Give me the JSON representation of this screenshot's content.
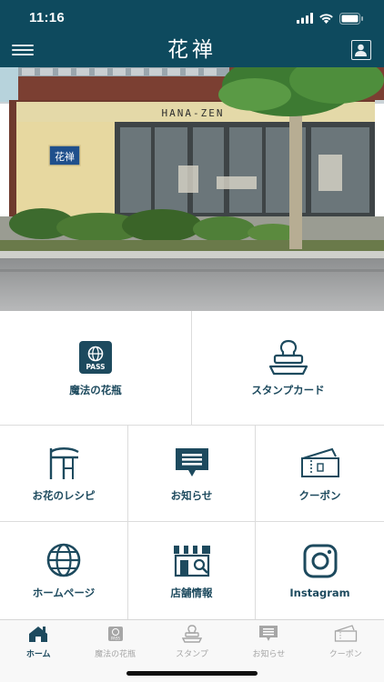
{
  "status": {
    "time": "11:16"
  },
  "header": {
    "title": "花禅"
  },
  "hero": {
    "sign_text": "HANA-ZEN",
    "plaque_text": "花禅"
  },
  "tiles": [
    {
      "label": "魔法の花瓶",
      "icon": "pass-icon",
      "badge": "PASS"
    },
    {
      "label": "スタンプカード",
      "icon": "stamp-icon"
    },
    {
      "label": "お花のレシピ",
      "icon": "recipe-icon"
    },
    {
      "label": "お知らせ",
      "icon": "news-icon"
    },
    {
      "label": "クーポン",
      "icon": "coupon-icon"
    },
    {
      "label": "ホームページ",
      "icon": "globe-icon"
    },
    {
      "label": "店舗情報",
      "icon": "store-icon"
    },
    {
      "label": "Instagram",
      "icon": "instagram-icon"
    }
  ],
  "tabs": [
    {
      "label": "ホーム",
      "icon": "home-icon",
      "active": true
    },
    {
      "label": "魔法の花瓶",
      "icon": "pass-icon",
      "badge": "PASS"
    },
    {
      "label": "スタンプ",
      "icon": "stamp-icon"
    },
    {
      "label": "お知らせ",
      "icon": "news-icon"
    },
    {
      "label": "クーポン",
      "icon": "coupon-icon"
    }
  ],
  "colors": {
    "brand": "#0e4a5e",
    "tile_text": "#1d4a5e",
    "tab_inactive": "#a6a6a6"
  }
}
